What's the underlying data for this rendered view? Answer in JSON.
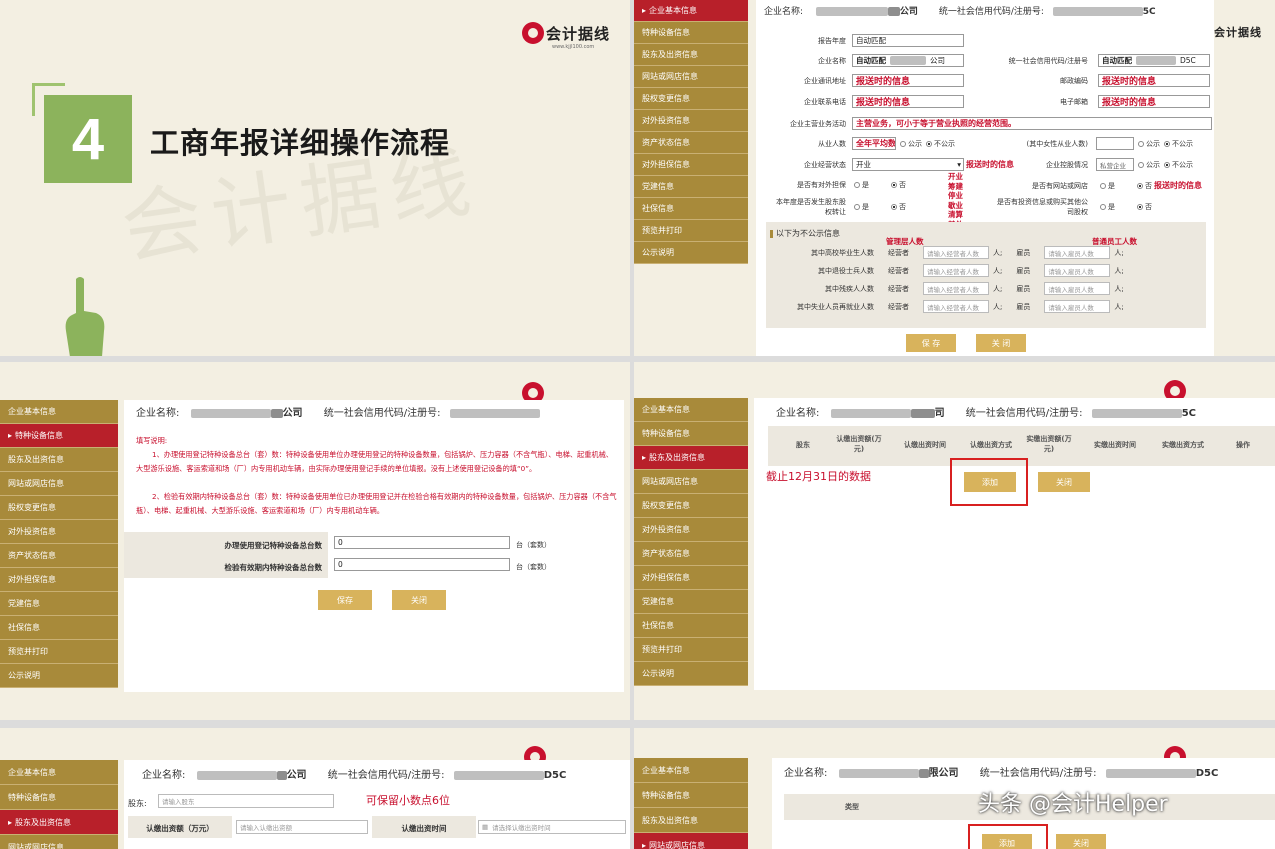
{
  "sidebar_items": {
    "i0": "企业基本信息",
    "i1": "特种设备信息",
    "i2": "股东及出资信息",
    "i3": "网站或网店信息",
    "i4": "股权变更信息",
    "i5": "对外投资信息",
    "i6": "资产状态信息",
    "i7": "对外担保信息",
    "i8": "党建信息",
    "i9": "社保信息",
    "i10": "预览并打印",
    "i11": "公示说明"
  },
  "brand": {
    "logo_text": "会计据线",
    "logo_url": "www.kjjl100.com",
    "watermark": "会计据线"
  },
  "slide1": {
    "number": "4",
    "title": "工商年报详细操作流程"
  },
  "common": {
    "company_name_label": "企业名称:",
    "company_suffix": "公司",
    "credit_code_label": "统一社会信用代码/注册号:",
    "credit_code_suffix": "5C",
    "save": "保存",
    "close": "关闭",
    "add": "添加",
    "save_spaced": "保 存",
    "close_spaced": "关 闭"
  },
  "slide2": {
    "report_year_label": "报告年度",
    "report_year_value": "自动匹配",
    "company_label": "企业名称",
    "company_value": "自动匹配",
    "company_value_suffix": "公司",
    "credit_label": "统一社会信用代码/注册号",
    "credit_value": "自动匹配",
    "credit_value_suffix": "D5C",
    "address_label": "企业通讯地址",
    "address_value": "报送时的信息",
    "postcode_label": "邮政编码",
    "postcode_value": "报送时的信息",
    "phone_label": "企业联系电话",
    "phone_value": "报送时的信息",
    "email_label": "电子邮箱",
    "email_value": "报送时的信息",
    "business_label": "企业主营业务活动",
    "business_value": "主营业务，可小于等于营业执照的经营范围。",
    "employees_label": "从业人数",
    "employees_value": "全年平均数",
    "public": "公示",
    "not_public": "不公示",
    "female_label": "(其中女性从业人数)",
    "status_label": "企业经营状态",
    "status_value": "开业",
    "status_note": "报送时的信息",
    "holding_label": "企业控股情况",
    "holding_value": "私营企业",
    "guarantee_label": "是否有对外担保",
    "yes": "是",
    "no": "否",
    "status_options": "开业 筹建 停业 歇业 清算 其他",
    "website_label": "是否有网站或网店",
    "website_note": "报送时的信息",
    "transfer_label": "本年度是否发生股东股权转让",
    "invest_label": "是否有投资信息或购买其他公司股权",
    "hidden_section": "以下为不公示信息",
    "manager_head": "管理层人数",
    "staff_head": "普通员工人数",
    "row1": "其中高校毕业生人数",
    "row2": "其中退役士兵人数",
    "row3": "其中残疾人人数",
    "row4": "其中失业人员再就业人数",
    "operator": "经营者",
    "employee": "雇员",
    "operator_ph": "请输入经营者人数",
    "employee_ph": "请输入雇员人数",
    "person_unit": "人;"
  },
  "slide3": {
    "note_title": "填写说明:",
    "note1": "1、办理使用登记特种设备总台（套）数：特种设备使用单位办理使用登记的特种设备数量，包括锅炉、压力容器（不含气瓶）、电梯、起重机械、大型游乐设施、客运索道和场（厂）内专用机动车辆，由实际办理使用登记手续的单位填报。没有上述使用登记设备的填“0”。",
    "note2": "2、检验有效期内特种设备总台（套）数：特种设备使用单位已办理使用登记并在检验合格有效期内的特种设备数量，包括锅炉、压力容器（不含气瓶）、电梯、起重机械、大型游乐设施、客运索道和场（厂）内专用机动车辆。",
    "field1_label": "办理使用登记特种设备总台数",
    "field1_value": "0",
    "field2_label": "检验有效期内特种设备总台数",
    "field2_value": "0",
    "unit": "台（套数）"
  },
  "slide4": {
    "col1": "股东",
    "col2": "认缴出资额(万元)",
    "col3": "认缴出资时间",
    "col4": "认缴出资方式",
    "col5": "实缴出资额(万元)",
    "col6": "实缴出资时间",
    "col7": "实缴出资方式",
    "col8": "操作",
    "annotation": "截止12月31日的数据"
  },
  "slide5": {
    "shareholder_label": "股东:",
    "shareholder_ph": "请输入股东",
    "annotation": "可保留小数点6位",
    "amount_label": "认缴出资额（万元）",
    "amount_ph": "请输入认缴出资额",
    "time_label": "认缴出资时间",
    "time_ph": "请选择认缴出资时间"
  },
  "slide6": {
    "col_type": "类型",
    "watermark": "头条 @会计Helper"
  }
}
